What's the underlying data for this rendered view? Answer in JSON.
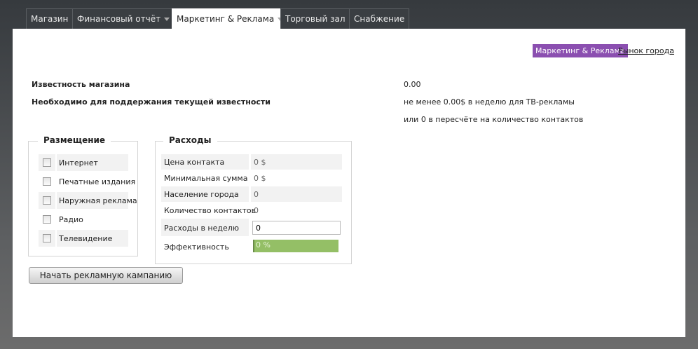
{
  "tabs": [
    {
      "label": "Магазин",
      "dropdown": false
    },
    {
      "label": "Финансовый отчёт",
      "dropdown": true
    },
    {
      "label": "Маркетинг & Реклама",
      "dropdown": true,
      "active": true
    },
    {
      "label": "Торговый зал",
      "dropdown": false
    },
    {
      "label": "Снабжение",
      "dropdown": false
    }
  ],
  "subnav": {
    "active": "Маркетинг & Реклама",
    "link": "Рынок города"
  },
  "info": {
    "fame_label": "Известность магазина",
    "fame_value": "0.00",
    "maintain_label": "Необходимо для поддержания текущей известности",
    "maintain_value": "не менее 0.00$  в неделю для ТВ-рекламы",
    "maintain_value2": "или 0 в пересчёте на количество контактов"
  },
  "placement": {
    "title": "Размещение",
    "items": [
      "Интернет",
      "Печатные издания",
      "Наружная реклама",
      "Радио",
      "Телевидение"
    ]
  },
  "expenses": {
    "title": "Расходы",
    "contact_price_label": "Цена контакта",
    "contact_price": "0 $",
    "min_sum_label": "Минимальная сумма",
    "min_sum": "0 $",
    "population_label": "Население города",
    "population": "0",
    "contacts_label": "Количество контактов",
    "contacts": "0",
    "weekly_label": "Расходы в неделю",
    "weekly": "0",
    "efficiency_label": "Эффективность",
    "efficiency": "0 %",
    "efficiency_percent": 0
  },
  "start_button": "Начать рекламную кампанию",
  "colors": {
    "accent": "#8b4fb0",
    "bar": "#94bf66"
  }
}
